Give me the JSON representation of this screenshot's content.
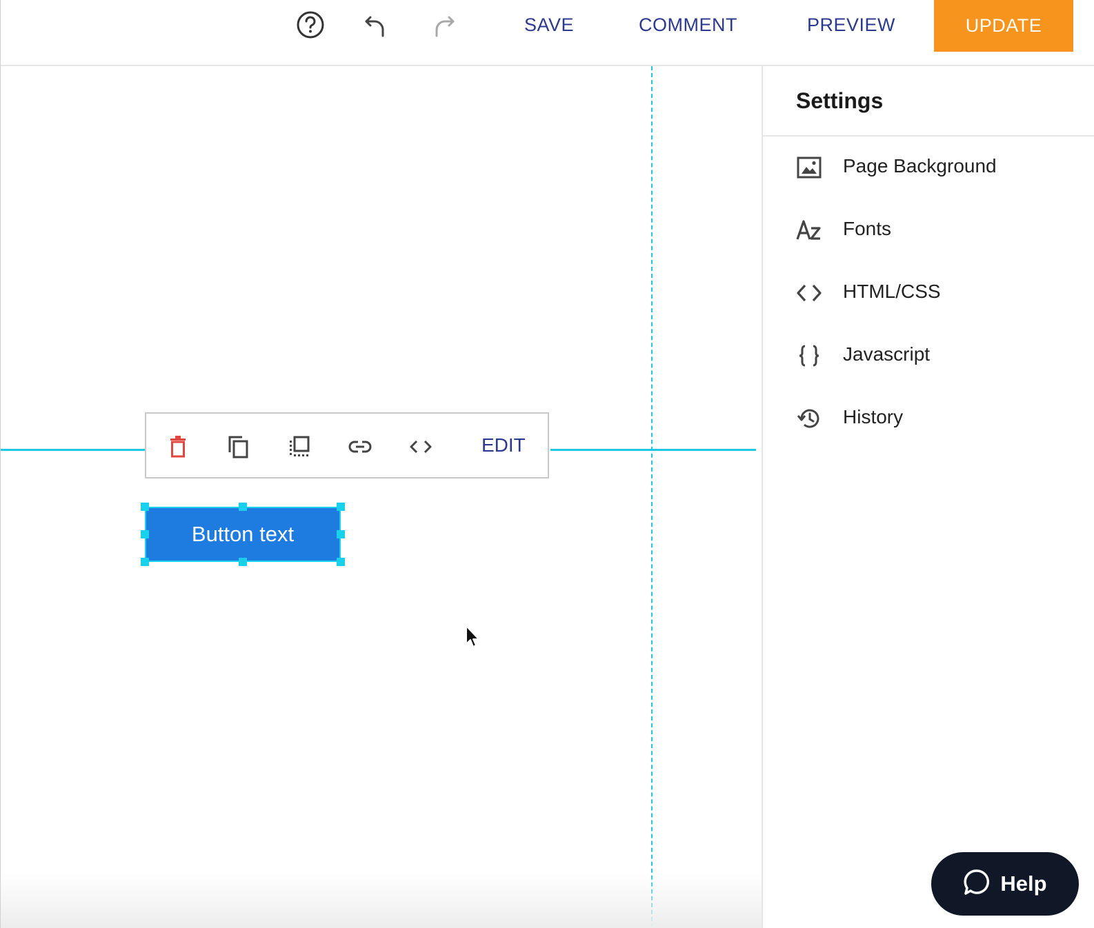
{
  "toolbar": {
    "help_icon": "help-circle-icon",
    "undo_icon": "undo-icon",
    "redo_icon": "redo-icon",
    "save_label": "SAVE",
    "comment_label": "COMMENT",
    "preview_label": "PREVIEW",
    "update_label": "UPDATE",
    "colors": {
      "link": "#2b3990",
      "update_bg": "#f7941d"
    }
  },
  "element_toolbar": {
    "icons": [
      "delete-icon",
      "duplicate-icon",
      "select-parent-icon",
      "link-icon",
      "code-icon"
    ],
    "edit_label": "EDIT"
  },
  "selected_element": {
    "label": "Button text",
    "colors": {
      "background": "#1e7be0",
      "selection": "#19d0ef"
    }
  },
  "sidebar": {
    "title": "Settings",
    "items": [
      {
        "label": "Page Background",
        "icon": "image-icon"
      },
      {
        "label": "Fonts",
        "icon": "az-icon"
      },
      {
        "label": "HTML/CSS",
        "icon": "code-icon"
      },
      {
        "label": "Javascript",
        "icon": "braces-icon"
      },
      {
        "label": "History",
        "icon": "history-icon"
      }
    ]
  },
  "help_widget": {
    "label": "Help",
    "icon": "chat-bubble-icon",
    "color": "#101828"
  }
}
